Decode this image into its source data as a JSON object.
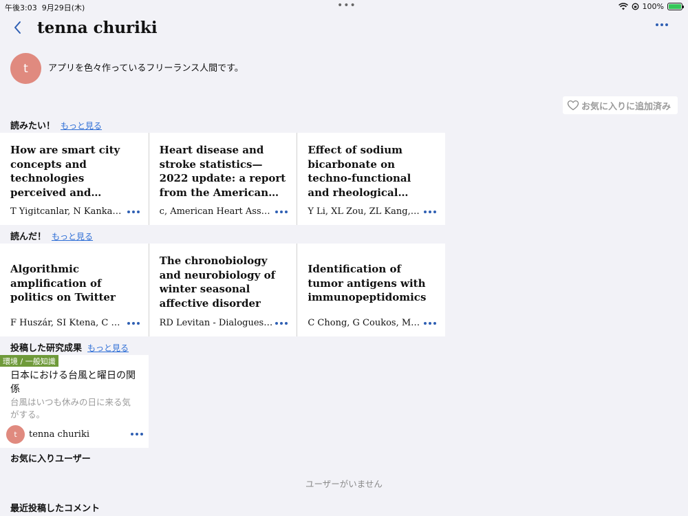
{
  "status_bar": {
    "time": "午後3:03",
    "date": "9月29日(木)",
    "battery": "100%",
    "dots": "•••"
  },
  "nav": {
    "title": "tenna churiki"
  },
  "profile": {
    "avatar_initial": "t",
    "bio": "アプリを色々作っているフリーランス人間です。",
    "favorite_button_label": "お気に入りに追加済み"
  },
  "sections": {
    "want_to_read": {
      "label": "読みたい！",
      "more": "もっと見る",
      "cards": [
        {
          "title": "How are smart city concepts and technologies perceived and utilized? A systematic geographic review",
          "authors": "T Yigitcanlar, N Kankanamge"
        },
        {
          "title": "Heart disease and stroke statistics—2022 update: a report from the American Heart Association",
          "authors": "c, American Heart Association"
        },
        {
          "title": "Effect of sodium bicarbonate on techno-functional and rheological properties of pea protein",
          "authors": "Y Li, XL Zou, ZL Kang, H Ma"
        }
      ]
    },
    "read": {
      "label": "読んだ！",
      "more": "もっと見る",
      "cards": [
        {
          "title": "Algorithmic amplification of politics on Twitter",
          "authors": "F Huszár, SI Ktena, C O'Brien"
        },
        {
          "title": "The chronobiology and neurobiology of winter seasonal affective disorder",
          "authors": "RD Levitan - Dialogues in clinical"
        },
        {
          "title": "Identification of tumor antigens with immunopeptidomics",
          "authors": "C Chong, G Coukos, M Bassani"
        }
      ]
    },
    "posted": {
      "label": "投稿した研究成果",
      "more": "もっと見る",
      "post": {
        "tag": "環境 / 一般知識",
        "title": "日本における台風と曜日の関係",
        "description": "台風はいつも休みの日に来る気がする。",
        "user_initial": "t",
        "user_name": "tenna churiki"
      }
    },
    "favorite_users": {
      "label": "お気に入りユーザー",
      "empty": "ユーザーがいません"
    },
    "recent_comments": {
      "label": "最近投稿したコメント"
    }
  },
  "colors": {
    "accent": "#2f5fb3",
    "link": "#2f6fd6",
    "avatar": "#e08a7f",
    "tag": "#6f9a3a",
    "background": "#f2f2f7"
  }
}
